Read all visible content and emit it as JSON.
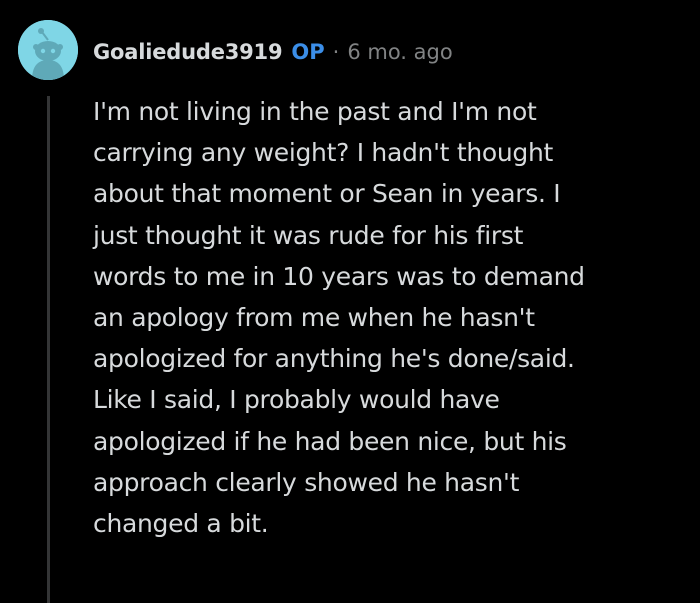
{
  "comment": {
    "avatar_icon": "reddit-snoo-avatar-icon",
    "author": "Goaliedude3919",
    "op_badge": "OP",
    "separator": "·",
    "timestamp": "6 mo. ago",
    "lines": [
      "I'm not living in the past and I'm not",
      "carrying any weight? I hadn't thought",
      "about that moment or Sean in years. I",
      "just thought it was rude for his first",
      "words to me in 10 years was to demand",
      "an apology from me when he hasn't",
      "apologized for anything he's done/said.",
      "Like I said, I probably would have",
      "apologized if he had been nice, but his",
      "approach clearly showed he hasn't",
      "changed a bit."
    ]
  },
  "colors": {
    "background": "#000000",
    "text": "#d7dadc",
    "muted": "#818384",
    "op_badge": "#3b8ee8",
    "avatar_bg": "#7fd6e6",
    "thread_line": "#343536"
  }
}
